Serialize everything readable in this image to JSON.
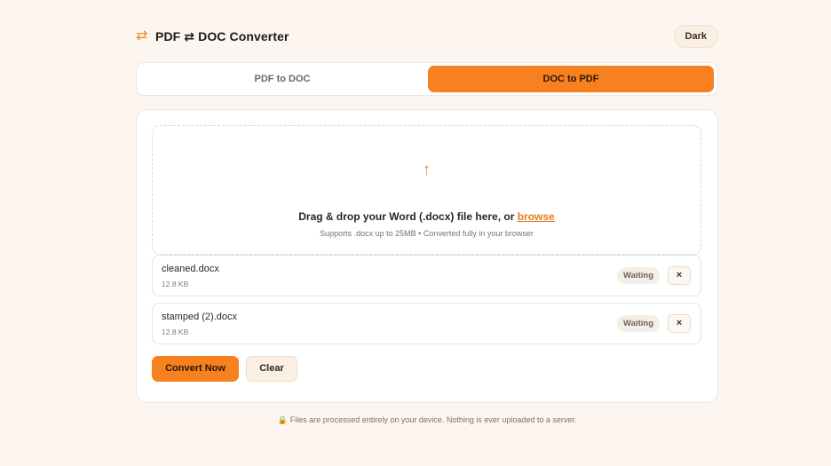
{
  "header": {
    "icon": "swap-arrows-icon",
    "title": "PDF ⇄ DOC Converter",
    "theme_button": "Dark"
  },
  "tabs": [
    {
      "label": "PDF to DOC",
      "active": false
    },
    {
      "label": "DOC to PDF",
      "active": true
    }
  ],
  "dropzone": {
    "icon": "upload-arrow-icon",
    "title": "Drag & drop your Word (.docx) file here, or ",
    "link": "browse",
    "subtitle": "Supports .docx up to 25MB • Converted fully in your browser"
  },
  "files": [
    {
      "name": "cleaned.docx",
      "size": "12.8 KB",
      "status": "Waiting",
      "remove": "×"
    },
    {
      "name": "stamped (2).docx",
      "size": "12.8 KB",
      "status": "Waiting",
      "remove": "×"
    }
  ],
  "actions": {
    "convert": "Convert Now",
    "clear": "Clear"
  },
  "footer": {
    "icon": "lock-icon",
    "text": "Files are processed entirely on your device. Nothing is ever uploaded to a server."
  },
  "colors": {
    "accent": "#f7801f",
    "background": "#fdf6f0"
  }
}
